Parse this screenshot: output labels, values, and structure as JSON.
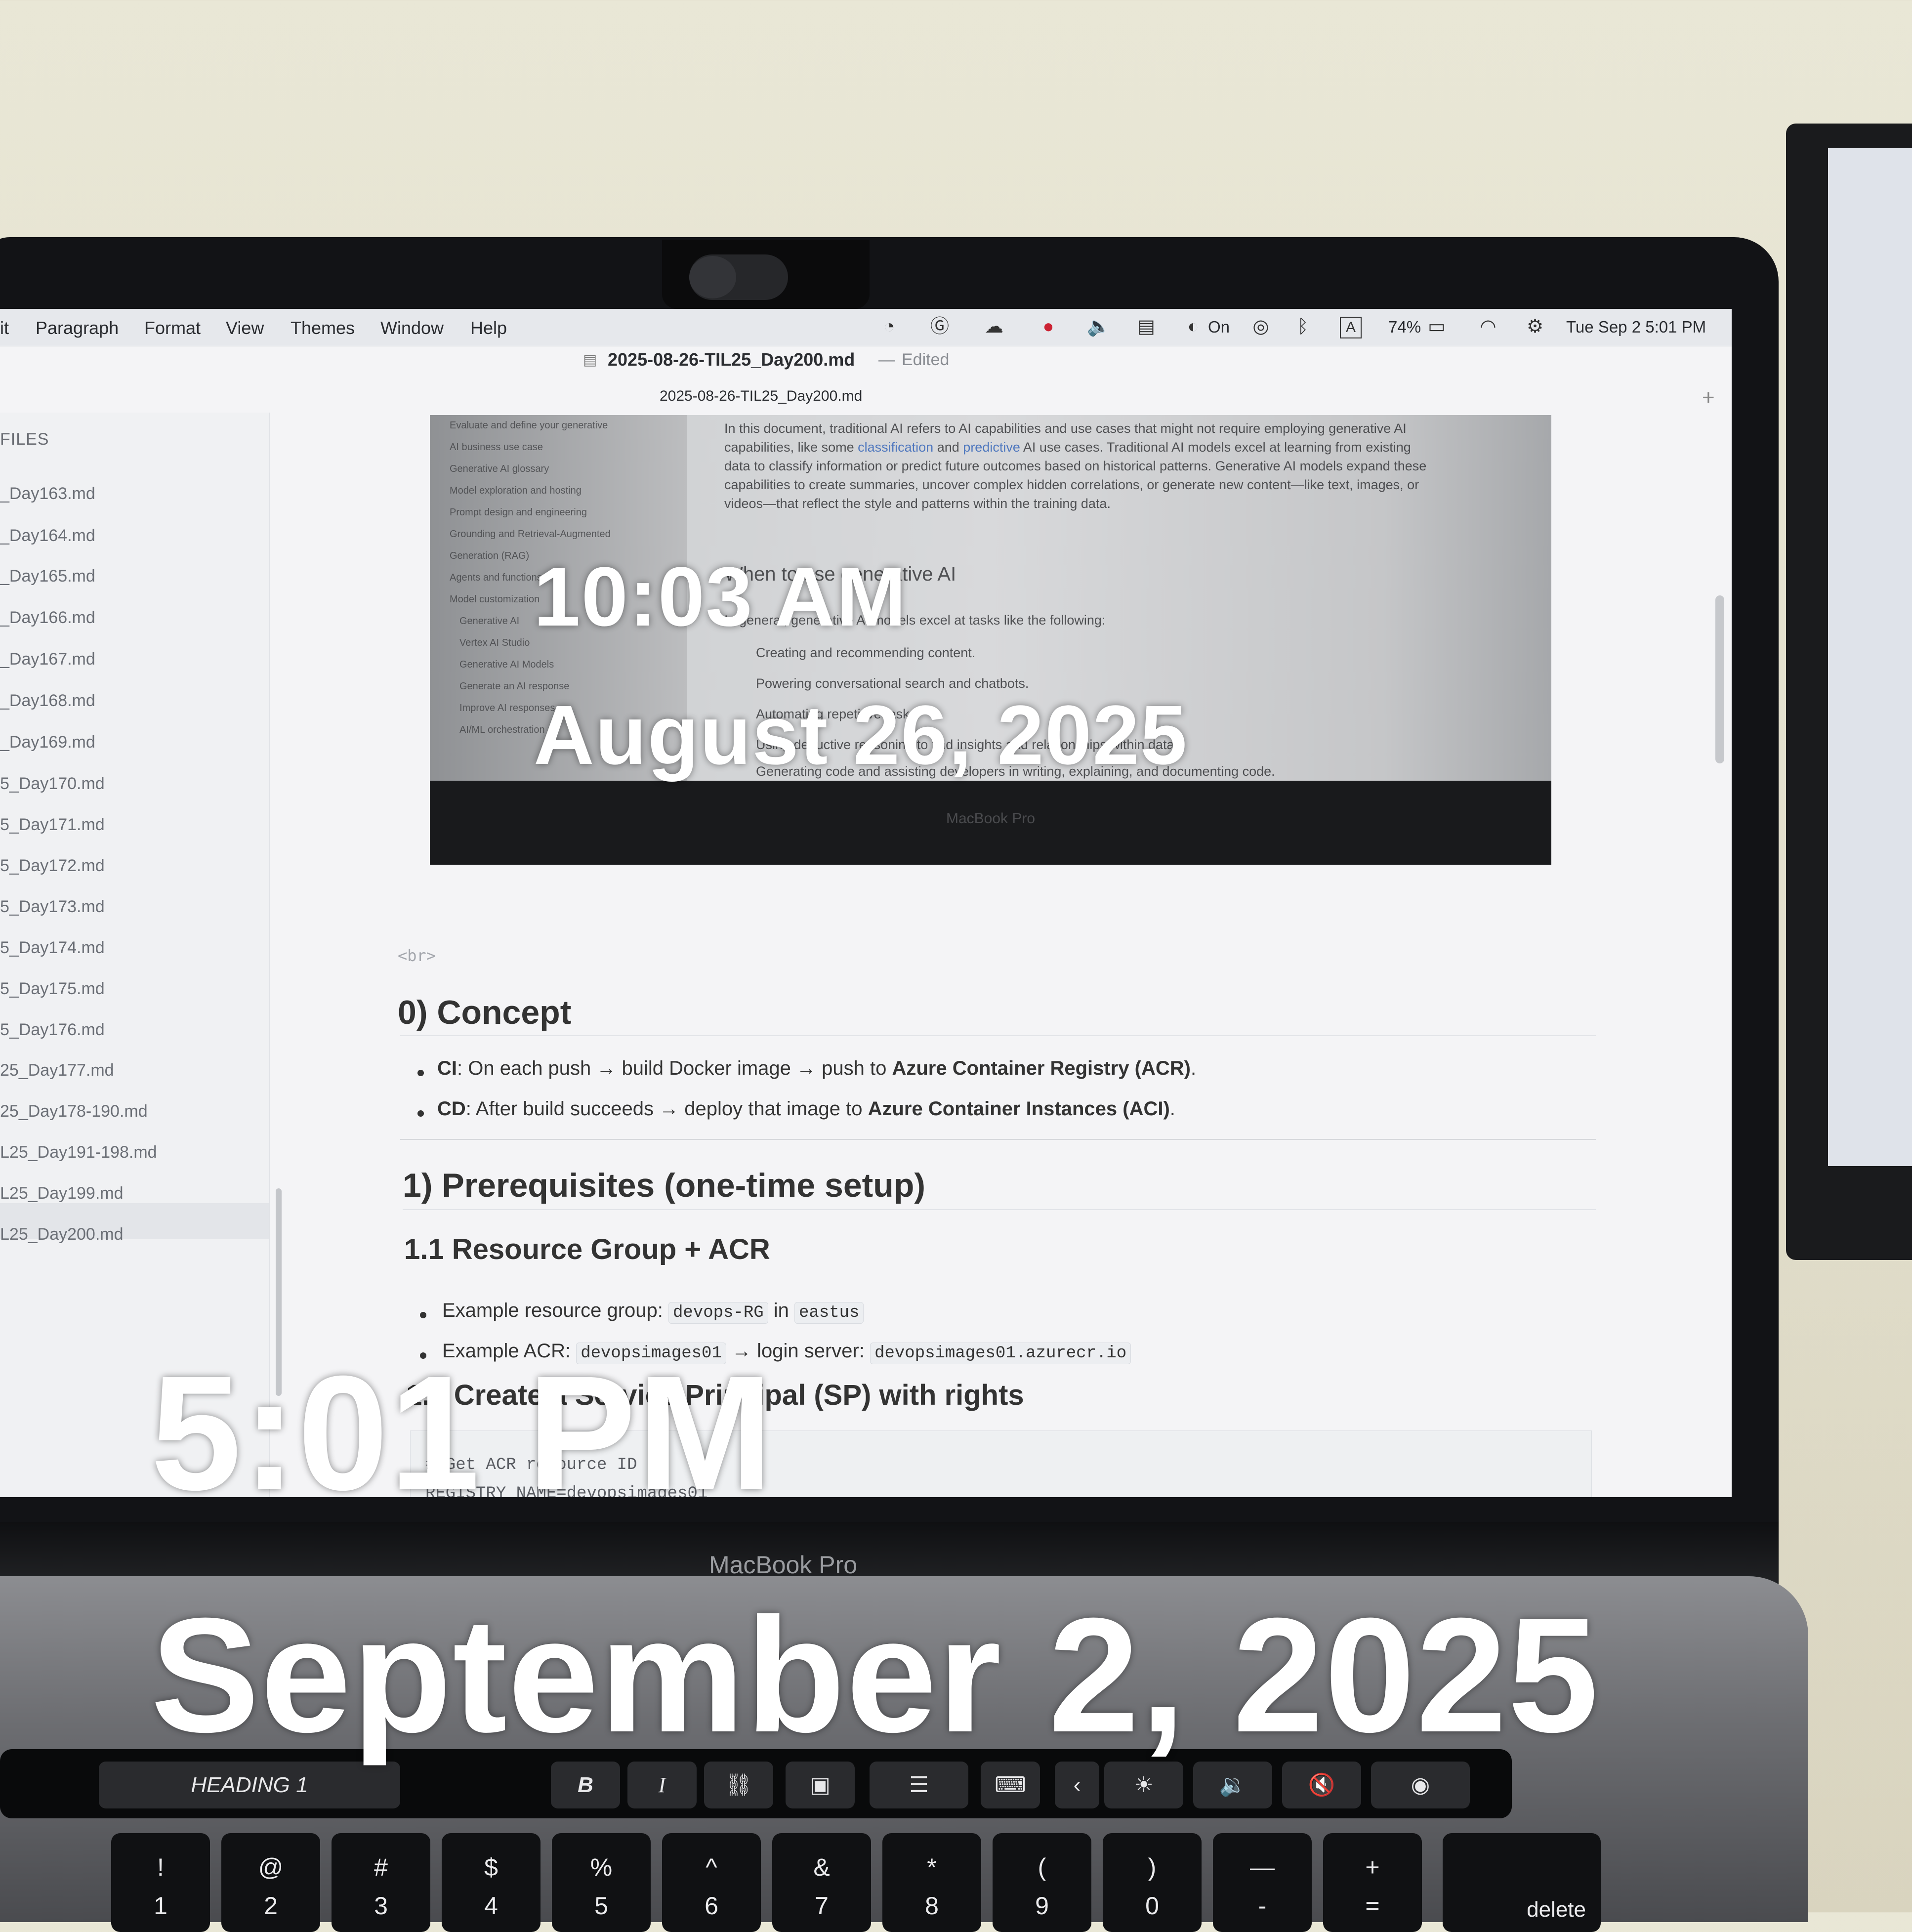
{
  "menubar": {
    "items": [
      "it",
      "Paragraph",
      "Format",
      "View",
      "Themes",
      "Window",
      "Help"
    ],
    "battery": "74%",
    "focus_status": "On",
    "keyboard_input": "A",
    "datetime": "Tue Sep 2  5:01 PM"
  },
  "window": {
    "title": "2025-08-26-TIL25_Day200.md",
    "separator": "—",
    "edited": "Edited",
    "tab_title": "2025-08-26-TIL25_Day200.md",
    "tab_add": "+"
  },
  "sidebar": {
    "label": "FILES",
    "files": [
      "_Day163.md",
      "_Day164.md",
      "_Day165.md",
      "_Day166.md",
      "_Day167.md",
      "_Day168.md",
      "_Day169.md",
      "5_Day170.md",
      "5_Day171.md",
      "5_Day172.md",
      "5_Day173.md",
      "5_Day174.md",
      "5_Day175.md",
      "5_Day176.md",
      "25_Day177.md",
      "25_Day178-190.md",
      "L25_Day191-198.md",
      "L25_Day199.md",
      "L25_Day200.md"
    ]
  },
  "embedded_photo": {
    "side_nav": [
      "Evaluate and define your generative",
      "AI business use case",
      "Generative AI glossary",
      "Model exploration and hosting",
      "Prompt design and engineering",
      "Grounding and Retrieval-Augmented",
      "Generation (RAG)",
      "Agents and functions",
      "Model customization",
      "Generative AI",
      "Vertex AI Studio",
      "Generative AI Models",
      "Generate an AI response",
      "Improve AI responses",
      "AI/ML orchestration"
    ],
    "para_lines": [
      "In this document, traditional AI refers to AI capabilities and use cases that might not require employing generative AI",
      "capabilities, like some",
      "classification",
      "and",
      "predictive",
      "AI use cases. Traditional AI models excel at learning from existing",
      "data to classify information or predict future outcomes based on historical patterns. Generative AI models expand these",
      "capabilities to create summaries, uncover complex hidden correlations, or generate new content—like text, images, or",
      "videos—that reflect the style and patterns within the training data."
    ],
    "heading": "When to use generative AI",
    "intro": "In general, generative AI models excel at tasks like the following:",
    "bullets": [
      "Creating and recommending content.",
      "Powering conversational search and chatbots.",
      "Automating repetitive tasks.",
      "Using deductive reasoning to find insights and relationships within data.",
      "Generating code and assisting developers in writing, explaining, and documenting code."
    ],
    "bezel_label": "MacBook Pro",
    "overlay_time": "10:03 AM",
    "overlay_date": "August 26, 2025"
  },
  "document": {
    "br_tag": "<br>",
    "h_concept": "0) Concept",
    "concept_bullets": [
      {
        "label": "CI",
        "pre": ": On each push → build Docker image → push to ",
        "bold": "Azure Container Registry (ACR)",
        "post": "."
      },
      {
        "label": "CD",
        "pre": ": After build succeeds → deploy that image to ",
        "bold": "Azure Container Instances (ACI)",
        "post": "."
      }
    ],
    "h_prereq": "1) Prerequisites (one-time setup)",
    "h_rg": "1.1 Resource Group + ACR",
    "rg_bullet": {
      "text": "Example resource group: ",
      "code1": "devops-RG",
      "mid": " in ",
      "code2": "eastus"
    },
    "acr_bullet": {
      "text": "Example ACR: ",
      "code1": "devopsimages01",
      "mid": " → login server: ",
      "code2": "devopsimages01.azurecr.io"
    },
    "h_sp": "1.2 Create a Service Principal (SP) with rights",
    "code_lines": [
      "# Get ACR resource ID",
      "REGISTRY_NAME=devopsimages01"
    ]
  },
  "laptop": {
    "label": "MacBook Pro"
  },
  "overlay": {
    "time": "5:01 PM",
    "date": "September 2, 2025"
  },
  "touchbar": {
    "heading": "HEADING 1",
    "bold": "B",
    "italic": "I"
  },
  "keyboard": {
    "keys": [
      {
        "top": "!",
        "bot": "1"
      },
      {
        "top": "@",
        "bot": "2"
      },
      {
        "top": "#",
        "bot": "3"
      },
      {
        "top": "$",
        "bot": "4"
      },
      {
        "top": "%",
        "bot": "5"
      },
      {
        "top": "^",
        "bot": "6"
      },
      {
        "top": "&",
        "bot": "7"
      },
      {
        "top": "*",
        "bot": "8"
      },
      {
        "top": "(",
        "bot": "9"
      },
      {
        "top": ")",
        "bot": "0"
      },
      {
        "top": "—",
        "bot": "-"
      },
      {
        "top": "+",
        "bot": "="
      }
    ],
    "delete": "delete"
  }
}
